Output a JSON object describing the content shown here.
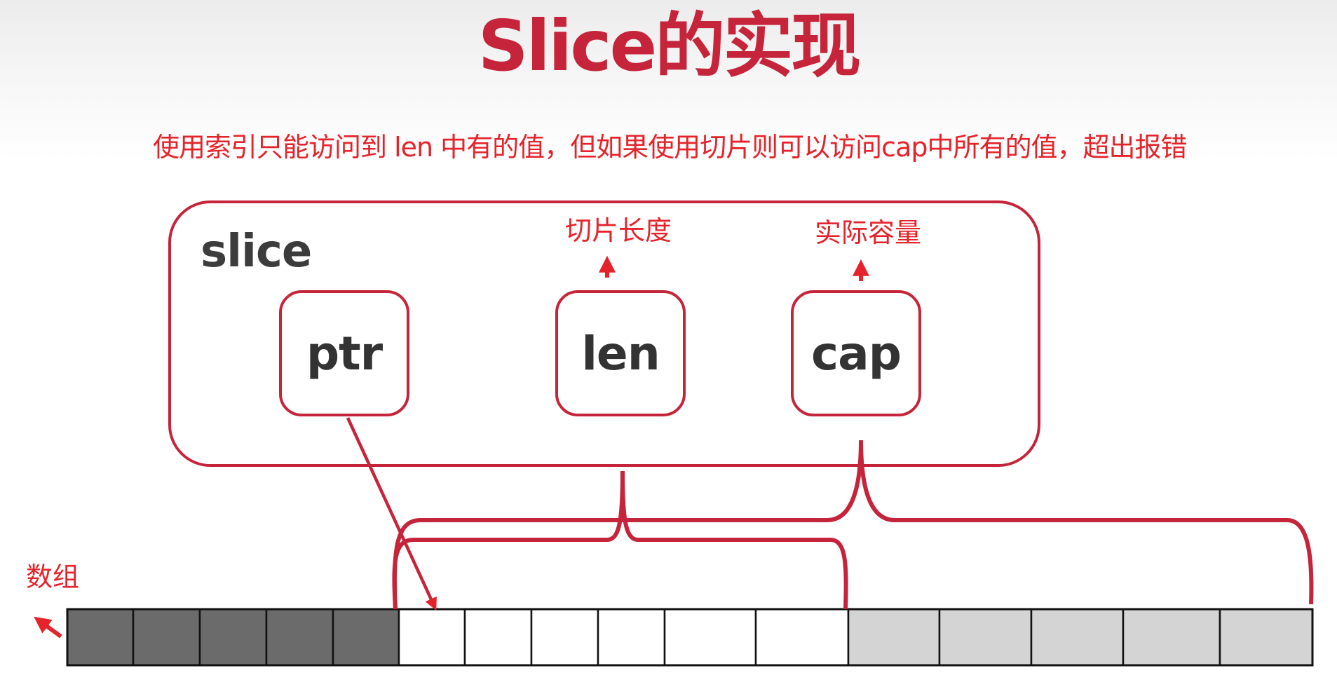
{
  "title": "Slice的实现",
  "subtitle": "使用索引只能访问到 len 中有的值，但如果使用切片则可以访问cap中所有的值，超出报错",
  "slice": {
    "label": "slice",
    "fields": [
      "ptr",
      "len",
      "cap"
    ]
  },
  "annotations": {
    "len_note": "切片长度",
    "cap_note": "实际容量",
    "array_label": "数组"
  },
  "array": {
    "cells": [
      {
        "state": "outside"
      },
      {
        "state": "outside"
      },
      {
        "state": "outside"
      },
      {
        "state": "outside"
      },
      {
        "state": "outside"
      },
      {
        "state": "len"
      },
      {
        "state": "len"
      },
      {
        "state": "len"
      },
      {
        "state": "len"
      },
      {
        "state": "len"
      },
      {
        "state": "len"
      },
      {
        "state": "cap"
      },
      {
        "state": "cap"
      },
      {
        "state": "cap"
      },
      {
        "state": "cap"
      },
      {
        "state": "cap"
      }
    ],
    "colors": {
      "outside": "#6b6b6b",
      "len": "#ffffff",
      "cap": "#d4d4d4"
    }
  },
  "colors": {
    "accent": "#c5243a",
    "note_red": "#e5232b",
    "text_dark": "#333333"
  }
}
